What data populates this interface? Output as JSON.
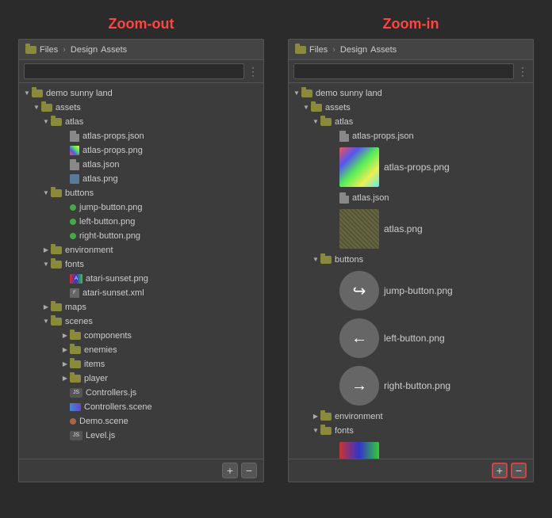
{
  "left_panel": {
    "title": "Zoom-out",
    "breadcrumb": [
      "Files",
      ">",
      "Design",
      "Assets"
    ],
    "search_placeholder": "",
    "tree": [
      {
        "id": "demo-sunny-land",
        "label": "demo sunny land",
        "type": "folder",
        "depth": 0,
        "open": true
      },
      {
        "id": "assets",
        "label": "assets",
        "type": "folder",
        "depth": 1,
        "open": true
      },
      {
        "id": "atlas",
        "label": "atlas",
        "type": "folder",
        "depth": 2,
        "open": true
      },
      {
        "id": "atlas-props-json",
        "label": "atlas-props.json",
        "type": "file-json",
        "depth": 3
      },
      {
        "id": "atlas-props-png",
        "label": "atlas-props.png",
        "type": "file-img-color",
        "depth": 3
      },
      {
        "id": "atlas-json",
        "label": "atlas.json",
        "type": "file-json",
        "depth": 3
      },
      {
        "id": "atlas-png",
        "label": "atlas.png",
        "type": "file-img-dots",
        "depth": 3
      },
      {
        "id": "buttons",
        "label": "buttons",
        "type": "folder",
        "depth": 2,
        "open": true
      },
      {
        "id": "jump-button-png",
        "label": "jump-button.png",
        "type": "file-dot-green",
        "depth": 3
      },
      {
        "id": "left-button-png",
        "label": "left-button.png",
        "type": "file-dot-green",
        "depth": 3
      },
      {
        "id": "right-button-png",
        "label": "right-button.png",
        "type": "file-dot-green",
        "depth": 3
      },
      {
        "id": "environment",
        "label": "environment",
        "type": "folder",
        "depth": 2,
        "open": false
      },
      {
        "id": "fonts",
        "label": "fonts",
        "type": "folder",
        "depth": 2,
        "open": true
      },
      {
        "id": "atari-sunset-png",
        "label": "atari-sunset.png",
        "type": "file-font-png",
        "depth": 3
      },
      {
        "id": "atari-sunset-xml",
        "label": "atari-sunset.xml",
        "type": "file-font-xml",
        "depth": 3
      },
      {
        "id": "maps",
        "label": "maps",
        "type": "folder",
        "depth": 2,
        "open": false
      },
      {
        "id": "scenes",
        "label": "scenes",
        "type": "folder",
        "depth": 2,
        "open": true
      },
      {
        "id": "components",
        "label": "components",
        "type": "folder",
        "depth": 3,
        "open": false
      },
      {
        "id": "enemies",
        "label": "enemies",
        "type": "folder",
        "depth": 3,
        "open": false
      },
      {
        "id": "items",
        "label": "items",
        "type": "folder",
        "depth": 3,
        "open": false
      },
      {
        "id": "player",
        "label": "player",
        "type": "folder",
        "depth": 3,
        "open": false
      },
      {
        "id": "controllers-js",
        "label": "Controllers.js",
        "type": "file-js",
        "depth": 3
      },
      {
        "id": "controllers-scene",
        "label": "Controllers.scene",
        "type": "file-scene",
        "depth": 3
      },
      {
        "id": "demo-scene",
        "label": "Demo.scene",
        "type": "file-dot-orange",
        "depth": 3
      },
      {
        "id": "level-js",
        "label": "Level.js",
        "type": "file-js",
        "depth": 3
      }
    ],
    "footer_plus": "+",
    "footer_minus": "−"
  },
  "right_panel": {
    "title": "Zoom-in",
    "breadcrumb": [
      "Files",
      ">",
      "Design",
      "Assets"
    ],
    "search_placeholder": "",
    "tree": [
      {
        "id": "demo-sunny-land",
        "label": "demo sunny land",
        "type": "folder",
        "depth": 0,
        "open": true
      },
      {
        "id": "assets",
        "label": "assets",
        "type": "folder",
        "depth": 1,
        "open": true
      },
      {
        "id": "atlas",
        "label": "atlas",
        "type": "folder",
        "depth": 2,
        "open": true
      },
      {
        "id": "atlas-props-json",
        "label": "atlas-props.json",
        "type": "file-json",
        "depth": 3
      },
      {
        "id": "atlas-props-png",
        "label": "atlas-props.png",
        "type": "thumb-color",
        "depth": 3
      },
      {
        "id": "atlas-json",
        "label": "atlas.json",
        "type": "file-json",
        "depth": 3
      },
      {
        "id": "atlas-png",
        "label": "atlas.png",
        "type": "thumb-dots",
        "depth": 3
      },
      {
        "id": "buttons",
        "label": "buttons",
        "type": "folder",
        "depth": 2,
        "open": true
      },
      {
        "id": "jump-button-png",
        "label": "jump-button.png",
        "type": "circle-arrow-right",
        "depth": 3
      },
      {
        "id": "left-button-png",
        "label": "left-button.png",
        "type": "circle-arrow-left",
        "depth": 3
      },
      {
        "id": "right-button-png",
        "label": "right-button.png",
        "type": "circle-arrow-right2",
        "depth": 3
      },
      {
        "id": "environment",
        "label": "environment",
        "type": "folder",
        "depth": 2,
        "open": false
      },
      {
        "id": "fonts",
        "label": "fonts",
        "type": "folder",
        "depth": 2,
        "open": true
      },
      {
        "id": "atari-sunset-png",
        "label": "",
        "type": "thumb-fonts",
        "depth": 3
      }
    ],
    "footer_plus": "+",
    "footer_minus": "−"
  }
}
